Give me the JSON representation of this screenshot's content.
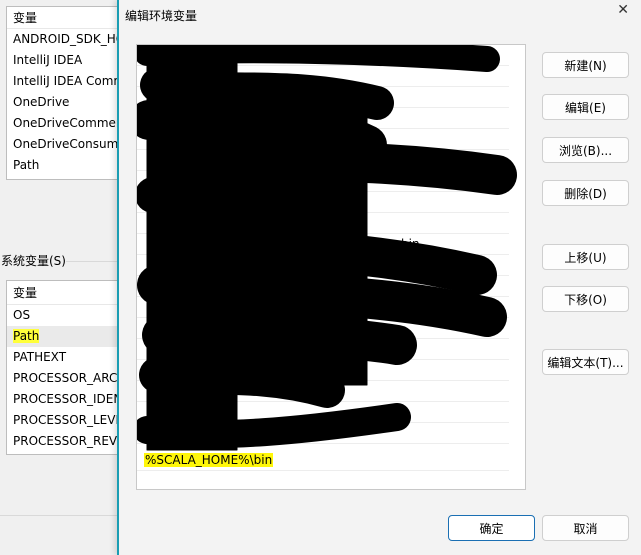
{
  "background": {
    "user_vars": {
      "header": "变量",
      "rows": [
        "ANDROID_SDK_HOME",
        "IntelliJ IDEA",
        "IntelliJ IDEA Community",
        "OneDrive",
        "OneDriveCommercial",
        "OneDriveConsumer",
        "Path"
      ]
    },
    "system_label": "系统变量(S)",
    "system_vars": {
      "header": "变量",
      "rows": [
        "OS",
        "Path",
        "PATHEXT",
        "PROCESSOR_ARCHITECTURE",
        "PROCESSOR_IDENTIFIER",
        "PROCESSOR_LEVEL",
        "PROCESSOR_REVISION"
      ],
      "selected": "Path"
    }
  },
  "dialog": {
    "title": "编辑环境变量",
    "close_glyph": "✕",
    "entries": {
      "visible_fragments": [
        "bin",
        "0",
        "..."
      ],
      "last_entry": "%SCALA_HOME%\\bin"
    },
    "buttons": {
      "new": "新建(N)",
      "edit": "编辑(E)",
      "browse": "浏览(B)...",
      "delete": "删除(D)",
      "move_up": "上移(U)",
      "move_down": "下移(O)",
      "edit_text": "编辑文本(T)...",
      "ok": "确定",
      "cancel": "取消"
    }
  },
  "colors": {
    "accent_border": "#1a9db3",
    "highlight": "#fff70a",
    "redaction": "#000000"
  }
}
